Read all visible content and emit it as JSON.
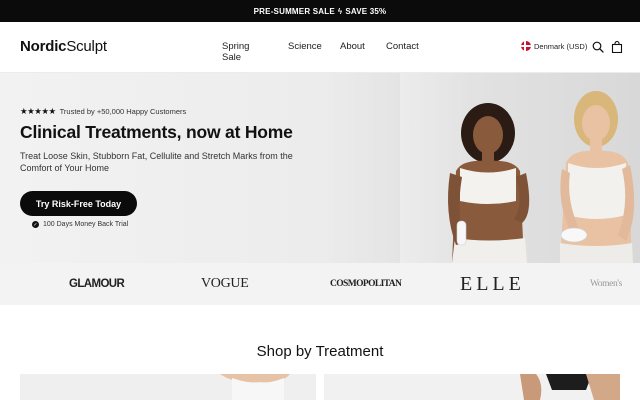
{
  "announcement": {
    "text_left": "PRE-SUMMER SALE",
    "text_right": "SAVE 35%",
    "icon": "lightning-icon"
  },
  "header": {
    "logo_bold": "Nordic",
    "logo_rest": "Sculpt",
    "nav": [
      "Spring Sale",
      "Science",
      "About",
      "Contact"
    ],
    "locale": "Denmark (USD)",
    "icons": [
      "denmark-flag-icon",
      "search-icon",
      "shopping-bag-icon"
    ]
  },
  "hero": {
    "stars": "★★★★★",
    "rating_text": "Trusted by +50,000 Happy Customers",
    "title": "Clinical Treatments, now at Home",
    "subtitle": "Treat Loose Skin, Stubborn Fat, Cellulite and Stretch Marks from the Comfort of Your Home",
    "cta": "Try Risk-Free Today",
    "trial_text": "100 Days Money Back Trial"
  },
  "press_logos": [
    "GLAMOUR",
    "VOGUE",
    "COSMOPOLITAN",
    "ELLE",
    "Women's"
  ],
  "shop": {
    "title": "Shop by Treatment"
  },
  "colors": {
    "announcement_bg": "#0b0b0b",
    "cta_bg": "#0b0b0b",
    "hero_bg": "#ececec",
    "press_bg": "#f3f3f3"
  }
}
